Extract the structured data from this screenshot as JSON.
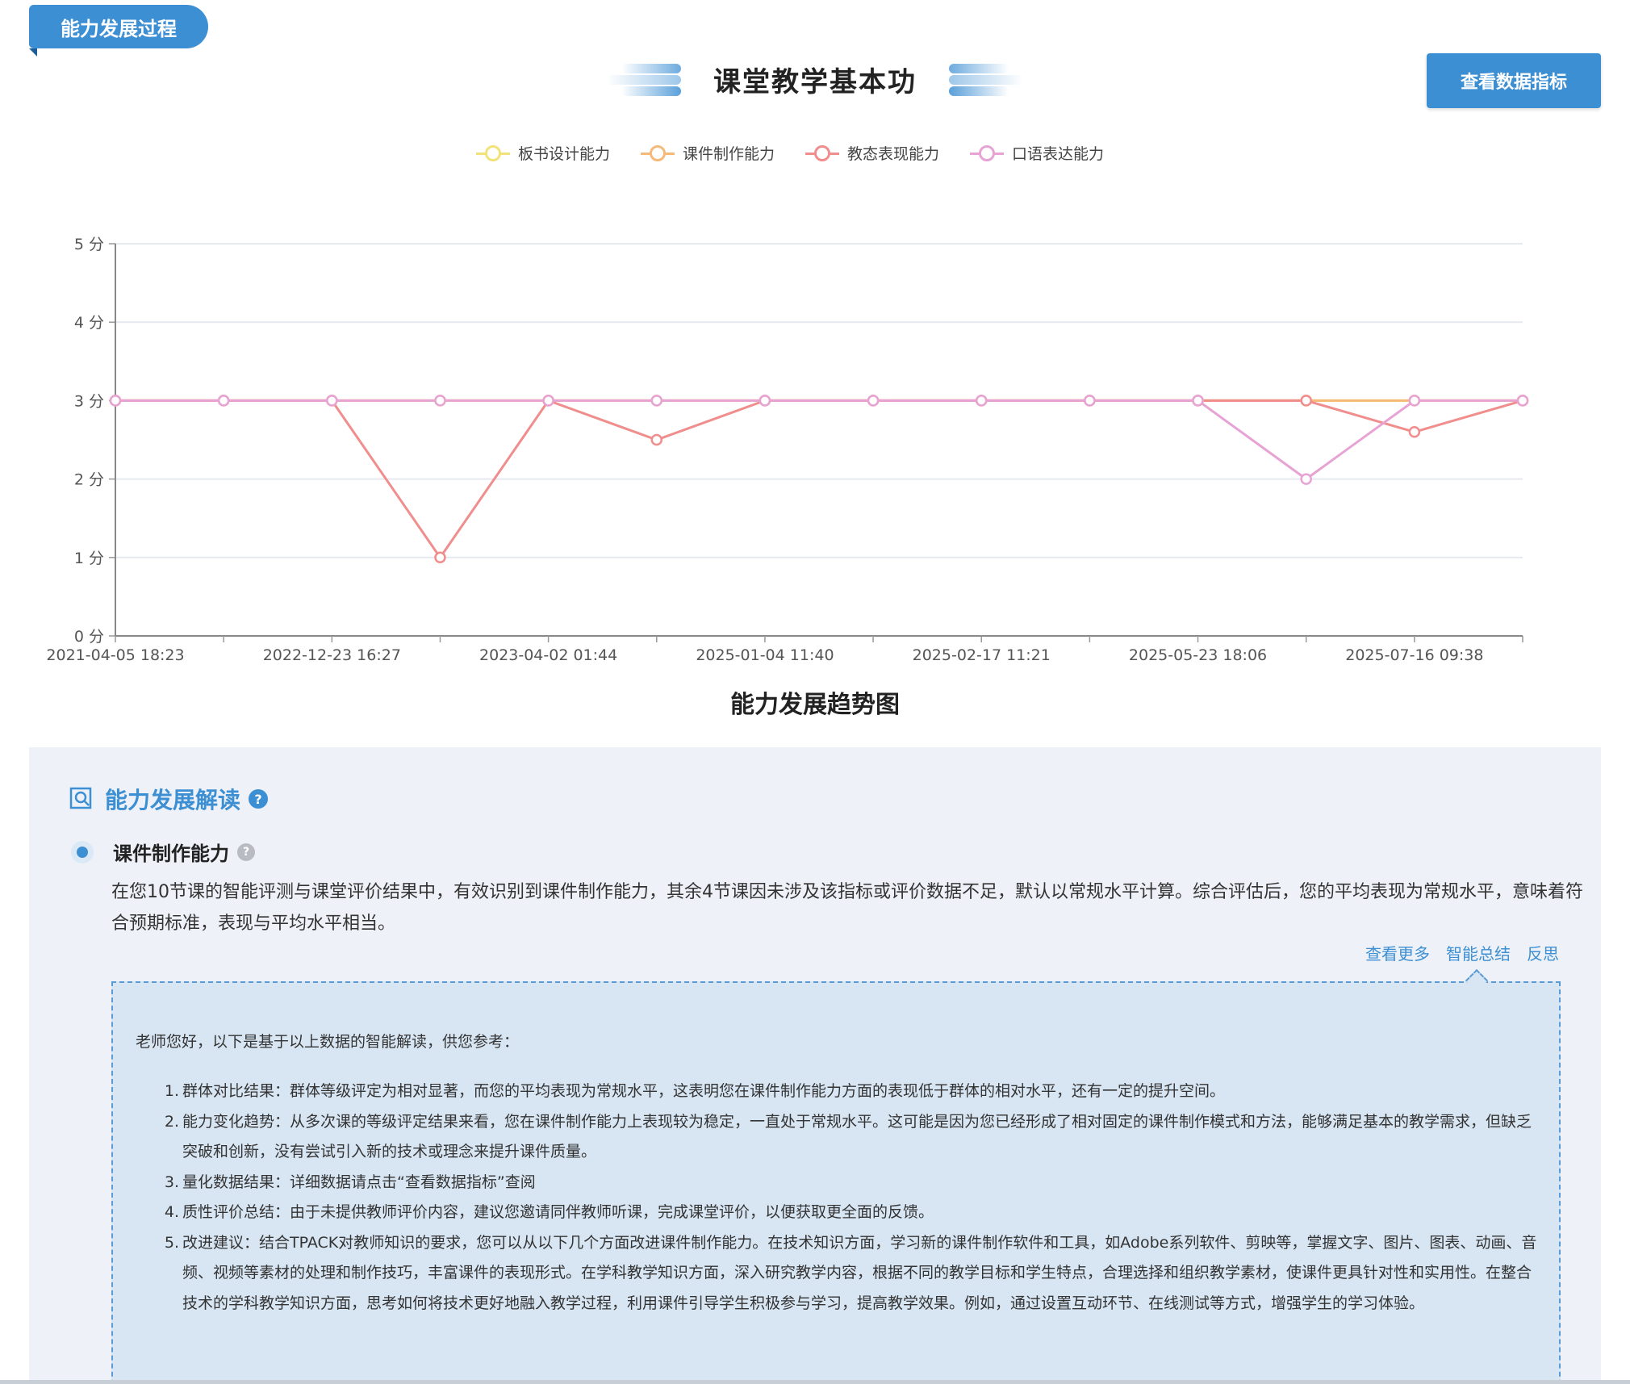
{
  "header": {
    "tag_label": "能力发展过程",
    "title": "课堂教学基本功",
    "view_data_button": "查看数据指标"
  },
  "legend": [
    {
      "label": "板书设计能力",
      "color": "#f2e27a"
    },
    {
      "label": "课件制作能力",
      "color": "#f5b97a"
    },
    {
      "label": "教态表现能力",
      "color": "#f08d8d"
    },
    {
      "label": "口语表达能力",
      "color": "#e7a3d4"
    }
  ],
  "chart_data": {
    "type": "line",
    "x": [
      "2021-04-05 18:23",
      "",
      "2022-12-23 16:27",
      "",
      "2023-04-02 01:44",
      "",
      "2025-01-04 11:40",
      "",
      "2025-02-17 11:21",
      "",
      "2025-05-23 18:06",
      "",
      "2025-07-16 09:38",
      ""
    ],
    "x_tick_labels": [
      "2021-04-05 18:23",
      "2022-12-23 16:27",
      "2023-04-02 01:44",
      "2025-01-04 11:40",
      "2025-02-17 11:21",
      "2025-05-23 18:06",
      "2025-07-16 09:38"
    ],
    "y_tick_labels": [
      "0 分",
      "1 分",
      "2 分",
      "3 分",
      "4 分",
      "5 分"
    ],
    "ylim": [
      0,
      5
    ],
    "grid": true,
    "series": [
      {
        "name": "板书设计能力",
        "color": "#f2e27a",
        "values": [
          3,
          3,
          3,
          3,
          3,
          3,
          3,
          3,
          3,
          3,
          3,
          3,
          3,
          3
        ]
      },
      {
        "name": "课件制作能力",
        "color": "#f5b97a",
        "values": [
          3,
          3,
          3,
          3,
          3,
          3,
          3,
          3,
          3,
          3,
          3,
          3,
          3,
          3
        ]
      },
      {
        "name": "教态表现能力",
        "color": "#f08d8d",
        "values": [
          3,
          3,
          3,
          1,
          3,
          2.5,
          3,
          3,
          3,
          3,
          3,
          3,
          2.6,
          3
        ]
      },
      {
        "name": "口语表达能力",
        "color": "#e7a3d4",
        "values": [
          3,
          3,
          3,
          3,
          3,
          3,
          3,
          3,
          3,
          3,
          3,
          2,
          3,
          3
        ]
      }
    ],
    "caption": "能力发展趋势图"
  },
  "analysis": {
    "section_title": "能力发展解读",
    "ability_title": "课件制作能力",
    "ability_desc": "在您10节课的智能评测与课堂评价结果中，有效识别到课件制作能力，其余4节课因未涉及该指标或评价数据不足，默认以常规水平计算。综合评估后，您的平均表现为常规水平，意味着符合预期标准，表现与平均水平相当。",
    "links": [
      "查看更多",
      "智能总结",
      "反思"
    ],
    "summary_intro": "老师您好，以下是基于以上数据的智能解读，供您参考：",
    "summary_items": [
      {
        "num": "1.",
        "text": "群体对比结果：群体等级评定为相对显著，而您的平均表现为常规水平，这表明您在课件制作能力方面的表现低于群体的相对水平，还有一定的提升空间。"
      },
      {
        "num": "2.",
        "text": "能力变化趋势：从多次课的等级评定结果来看，您在课件制作能力上表现较为稳定，一直处于常规水平。这可能是因为您已经形成了相对固定的课件制作模式和方法，能够满足基本的教学需求，但缺乏突破和创新，没有尝试引入新的技术或理念来提升课件质量。"
      },
      {
        "num": "3.",
        "text": "量化数据结果：详细数据请点击“查看数据指标”查阅"
      },
      {
        "num": "4.",
        "text": "质性评价总结：由于未提供教师评价内容，建议您邀请同伴教师听课，完成课堂评价，以便获取更全面的反馈。"
      },
      {
        "num": "5.",
        "text": "改进建议：结合TPACK对教师知识的要求，您可以从以下几个方面改进课件制作能力。在技术知识方面，学习新的课件制作软件和工具，如Adobe系列软件、剪映等，掌握文字、图片、图表、动画、音频、视频等素材的处理和制作技巧，丰富课件的表现形式。在学科教学知识方面，深入研究教学内容，根据不同的教学目标和学生特点，合理选择和组织教学素材，使课件更具针对性和实用性。在整合技术的学科教学知识方面，思考如何将技术更好地融入教学过程，利用课件引导学生积极参与学习，提高教学效果。例如，通过设置互动环节、在线测试等方式，增强学生的学习体验。"
      }
    ]
  }
}
